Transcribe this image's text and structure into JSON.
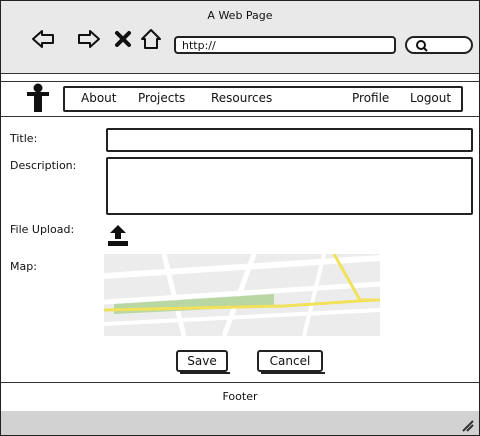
{
  "browser": {
    "title": "A Web Page",
    "url": "http://"
  },
  "nav": {
    "items": [
      "About",
      "Projects",
      "Resources"
    ],
    "profile": "Profile",
    "logout": "Logout"
  },
  "form": {
    "title_label": "Title:",
    "title_value": "",
    "description_label": "Description:",
    "description_value": "",
    "file_upload_label": "File Upload:",
    "map_label": "Map:",
    "save_label": "Save",
    "cancel_label": "Cancel"
  },
  "footer": {
    "text": "Footer"
  },
  "icons": {
    "back": "arrow-left-icon",
    "forward": "arrow-right-icon",
    "stop": "close-icon",
    "home": "home-icon",
    "search": "search-icon",
    "logo": "person-icon",
    "upload": "upload-icon",
    "resize": "resize-grip-icon"
  }
}
